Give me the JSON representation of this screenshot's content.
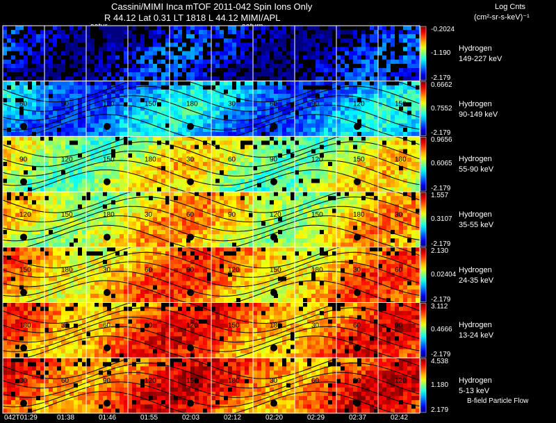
{
  "header": {
    "title": "Cassini/MIMI Inca mTOF  2011-042   Spin   Ions Only",
    "line2": "R         44.12 Lat 0.31 LT 1818 L        44.12  MIMI/APL",
    "saturn_label_1": "satur",
    "saturn_label_2": "saturn",
    "units_line1": "Log Cnts",
    "units_line2": "(cm²-sr-s-keV)⁻¹"
  },
  "footer": {
    "bfield_note": "B-field Particle Flow"
  },
  "colors": {
    "background": "#000000",
    "grid": "#ffffff",
    "contour": "#000000"
  },
  "chart_data": {
    "type": "heatmap",
    "xlabel": "",
    "time_labels": [
      "042T01:29",
      "01:38",
      "01:46",
      "01:55",
      "02:03",
      "02:12",
      "02:20",
      "02:29",
      "02:37",
      "02:42"
    ],
    "contour_labels": [
      "30",
      "60",
      "90",
      "120",
      "150",
      "180"
    ],
    "bands": [
      {
        "species": "Hydrogen",
        "energy": "149-227 keV",
        "cb_max": "-0.2024",
        "cb_mid": "-1.190",
        "cb_min": "-2.179",
        "level": 0.12
      },
      {
        "species": "Hydrogen",
        "energy": "90-149 keV",
        "cb_max": "0.6662",
        "cb_mid": "0.7552",
        "cb_min": "-2.179",
        "level": 0.3
      },
      {
        "species": "Hydrogen",
        "energy": "55-90 keV",
        "cb_max": "0.9656",
        "cb_mid": "0.6065",
        "cb_min": "-2.179",
        "level": 0.58
      },
      {
        "species": "Hydrogen",
        "energy": "35-55 keV",
        "cb_max": "1.557",
        "cb_mid": "0.3107",
        "cb_min": "-2.179",
        "level": 0.65
      },
      {
        "species": "Hydrogen",
        "energy": "24-35 keV",
        "cb_max": "2.130",
        "cb_mid": "0.02404",
        "cb_min": "-2.179",
        "level": 0.74
      },
      {
        "species": "Hydrogen",
        "energy": "13-24 keV",
        "cb_max": "3.112",
        "cb_mid": "0.4666",
        "cb_min": "-2.179",
        "level": 0.8
      },
      {
        "species": "Hydrogen",
        "energy": "5-13 keV",
        "cb_max": "4.538",
        "cb_mid": "1.180",
        "cb_min": "2.179",
        "level": 0.83
      }
    ]
  }
}
